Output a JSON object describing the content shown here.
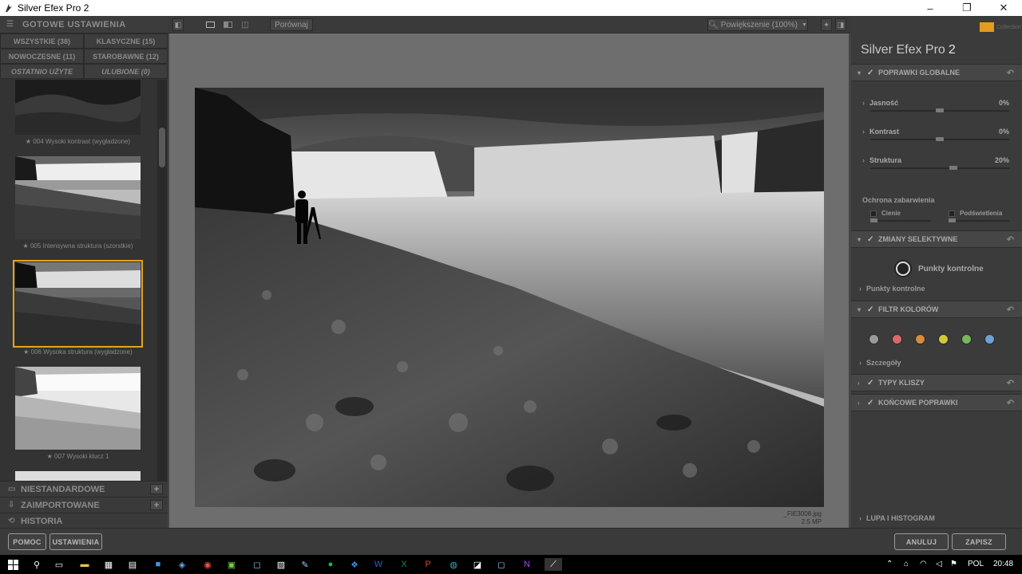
{
  "window": {
    "title": "Silver Efex Pro 2",
    "minimize": "–",
    "restore": "❐",
    "close": "✕"
  },
  "presets": {
    "header": "GOTOWE USTAWIENIA",
    "filters": [
      "WSZYSTKIE (38)",
      "KLASYCZNE (15)",
      "NOWOCZESNE (11)",
      "STAROBAWNE (12)",
      "OSTATNIO UŻYTE",
      "ULUBIONE (0)"
    ],
    "thumbs": [
      {
        "caption": "★ 004 Wysoki kontrast (wygładzone)"
      },
      {
        "caption": "★ 005 Intensywna struktura (szorstkie)"
      },
      {
        "caption": "★ 006 Wysoka struktura (wygładzone)"
      },
      {
        "caption": "★ 007 Wysoki klucz 1"
      }
    ],
    "sections": [
      {
        "label": "NIESTANDARDOWE",
        "plus": "+"
      },
      {
        "label": "ZAIMPORTOWANE",
        "plus": "+"
      },
      {
        "label": "HISTORIA"
      }
    ]
  },
  "toolbar": {
    "compare": "Porównaj",
    "zoom": "Powiększenie (100%)"
  },
  "image": {
    "filename": "_FIE3008.jpg",
    "size": "2.5 MP"
  },
  "panel": {
    "product": "Silver Efex Pro",
    "version": "2",
    "collection": "Collection",
    "global": {
      "header": "POPRAWKI GLOBALNE",
      "sliders": [
        {
          "label": "Jasność",
          "value": "0%",
          "level": 0.5
        },
        {
          "label": "Kontrast",
          "value": "0%",
          "level": 0.5
        },
        {
          "label": "Struktura",
          "value": "20%",
          "level": 0.6
        }
      ],
      "tonal_protection": "Ochrona zabarwienia",
      "shadows": "Cienie",
      "highlights": "Podświetlenia"
    },
    "selective": {
      "header": "ZMIANY SELEKTYWNE",
      "control_points_button": "Punkty kontrolne",
      "control_points_list": "Punkty kontrolne"
    },
    "color_filter": {
      "header": "FILTR KOLORÓW",
      "colors": [
        "#9a9a9a",
        "#d9686a",
        "#d98a3d",
        "#d0c93c",
        "#77b55a",
        "#6ea0d6"
      ],
      "details": "Szczegóły"
    },
    "film_types": {
      "header": "TYPY KLISZY"
    },
    "finishing": {
      "header": "KOŃCOWE POPRAWKI"
    },
    "loupe": "LUPA I HISTOGRAM"
  },
  "bottom": {
    "help": "POMOC",
    "settings": "USTAWIENIA",
    "cancel": "ANULUJ",
    "save": "ZAPISZ"
  },
  "taskbar": {
    "lang": "POL",
    "time": "20:48"
  }
}
